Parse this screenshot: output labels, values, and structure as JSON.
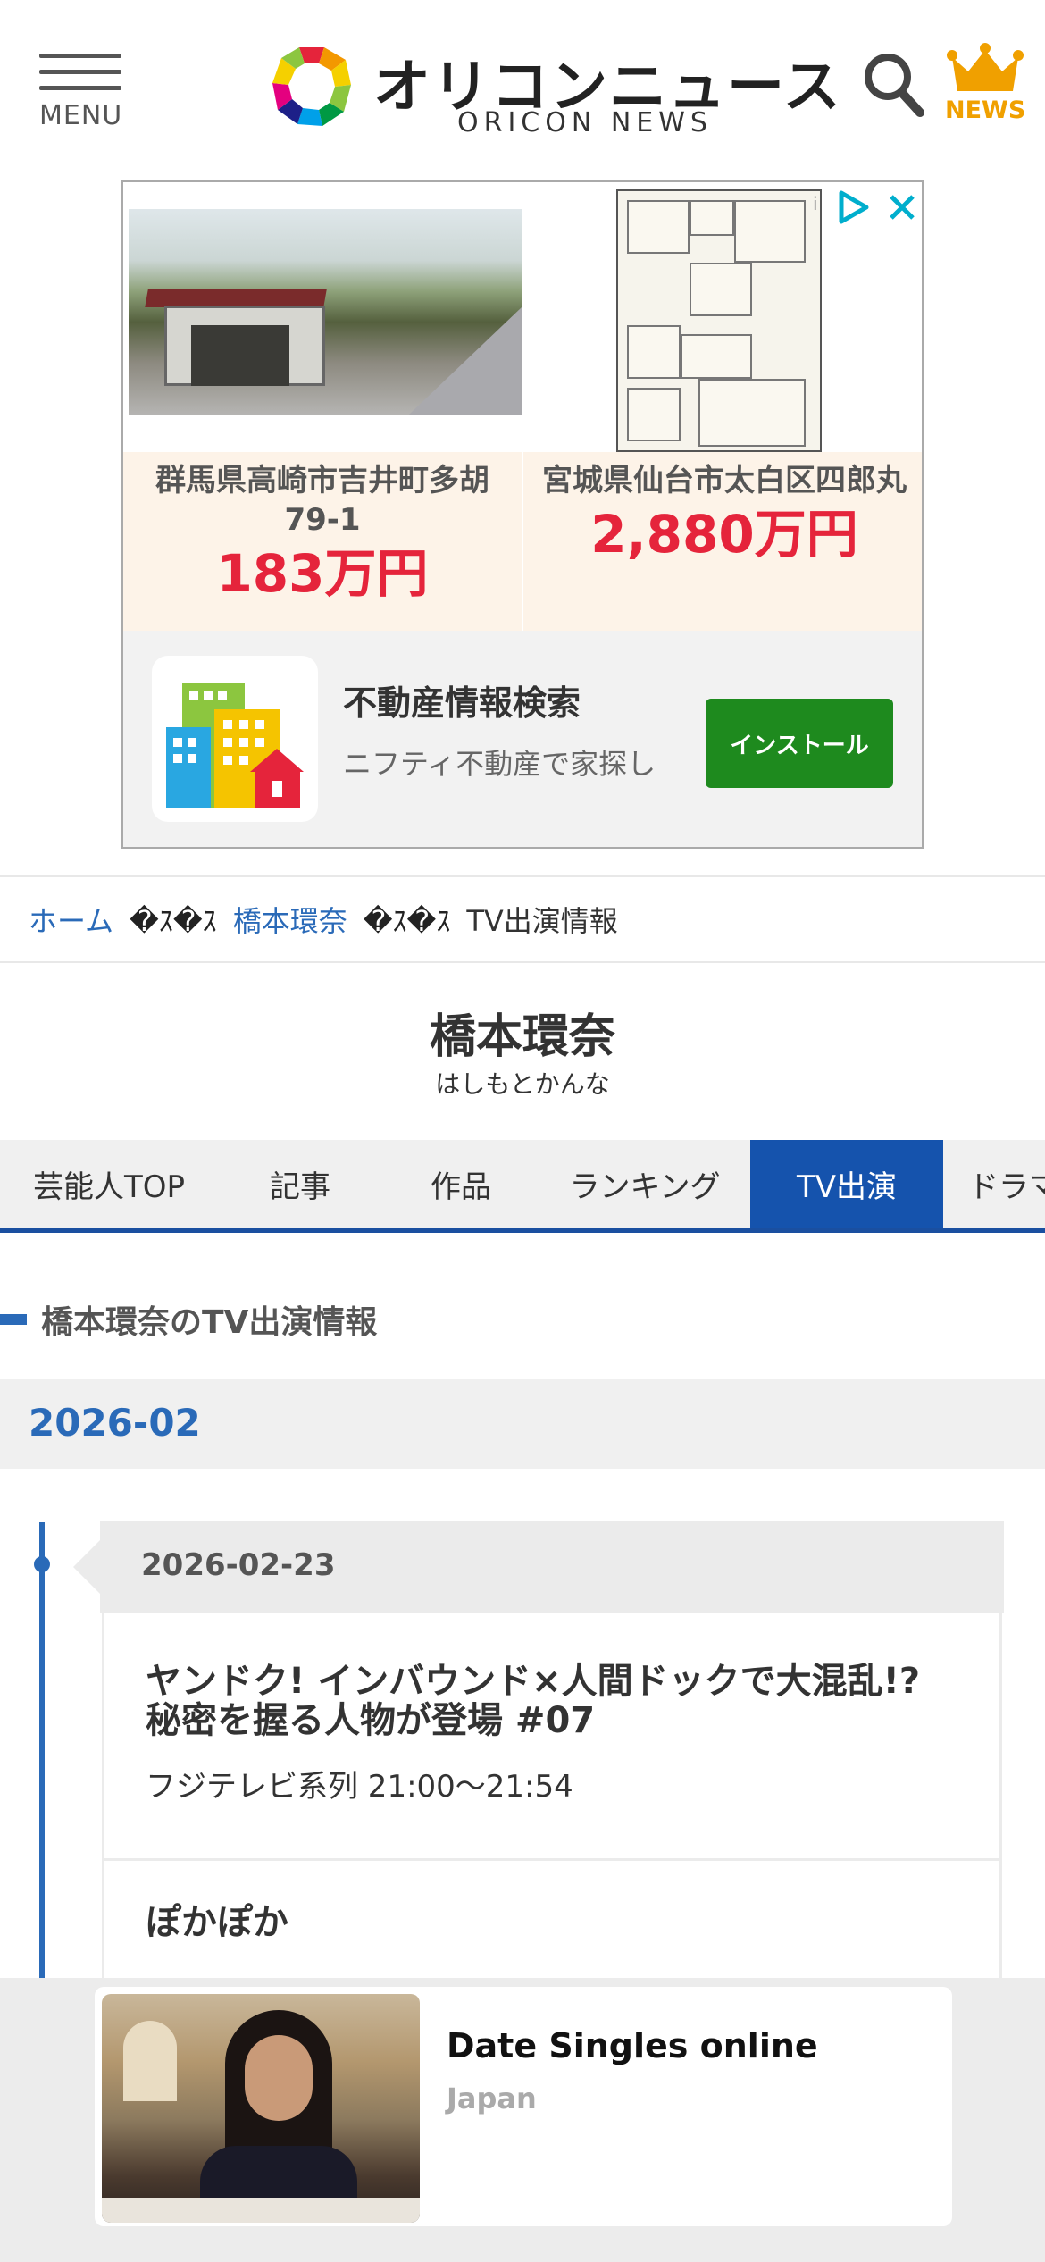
{
  "header": {
    "menu_label": "MENU",
    "logo_jp": "オリコンニュース",
    "logo_en": "ORICON NEWS",
    "news_label": "NEWS"
  },
  "ad": {
    "listings": [
      {
        "address": "群馬県高崎市吉井町多胡79-1",
        "price": "183万円"
      },
      {
        "address": "宮城県仙台市太白区四郎丸",
        "price": "2,880万円"
      }
    ],
    "app_title": "不動産情報検索",
    "app_desc": "ニフティ不動産で家探し",
    "install_label": "インストール",
    "info_label": "i"
  },
  "breadcrumb": {
    "items": [
      {
        "label": "ホーム"
      },
      {
        "label": "橋本環奈"
      },
      {
        "label": "TV出演情報"
      }
    ],
    "separator": "�ｽ�ｽ"
  },
  "page": {
    "title": "橋本環奈",
    "kana": "はしもとかんな"
  },
  "tabs": [
    {
      "label": "芸能人TOP"
    },
    {
      "label": "記事"
    },
    {
      "label": "作品"
    },
    {
      "label": "ランキング"
    },
    {
      "label": "TV出演",
      "active": true
    },
    {
      "label": "ドラマ"
    }
  ],
  "section_heading": "橋本環奈のTV出演情報",
  "month": "2026-02",
  "day": "2026-02-23",
  "programs": [
    {
      "title": "ヤンドク! インバウンド×人間ドックで大混乱!? 秘密を握る人物が登場 #07",
      "meta": "フジテレビ系列 21:00〜21:54"
    },
    {
      "title": "ぽかぽか",
      "meta": ""
    }
  ],
  "bottom_ad": {
    "title": "Date Singles online",
    "subtitle": "Japan"
  },
  "colors": {
    "accent_blue": "#1553ad",
    "link_blue": "#2a6ab8",
    "price_red": "#e5243b",
    "install_green": "#1e8a1e",
    "news_orange": "#f0a000"
  }
}
